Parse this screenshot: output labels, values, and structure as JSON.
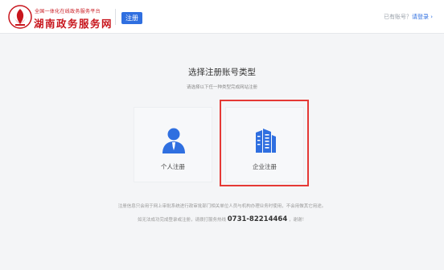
{
  "header": {
    "logo_sub": "全国一体化在线政务服务平台",
    "logo_main": "湖南政务服务网",
    "tag": "注册",
    "login_prefix": "已有账号？",
    "login_link": "请登录 ›"
  },
  "main": {
    "title": "选择注册账号类型",
    "subtitle": "请选择以下任一种类型完成网站注册",
    "cards": [
      {
        "label": "个人注册",
        "icon": "person-icon"
      },
      {
        "label": "企业注册",
        "icon": "building-icon"
      }
    ]
  },
  "footer": {
    "note1": "注册信息只会用于网上审批系统进行政审批部门相关单位人员与机构办理业务时使用，不会用做其它用途。",
    "note2_prefix": "如无法成功完成登录或注册，请拨打服务热线",
    "phone": "0731-82214464",
    "note2_suffix": "，谢谢！"
  },
  "colors": {
    "brand_red": "#c8161d",
    "accent_blue": "#2f6fe0",
    "highlight_red": "#e53935"
  }
}
